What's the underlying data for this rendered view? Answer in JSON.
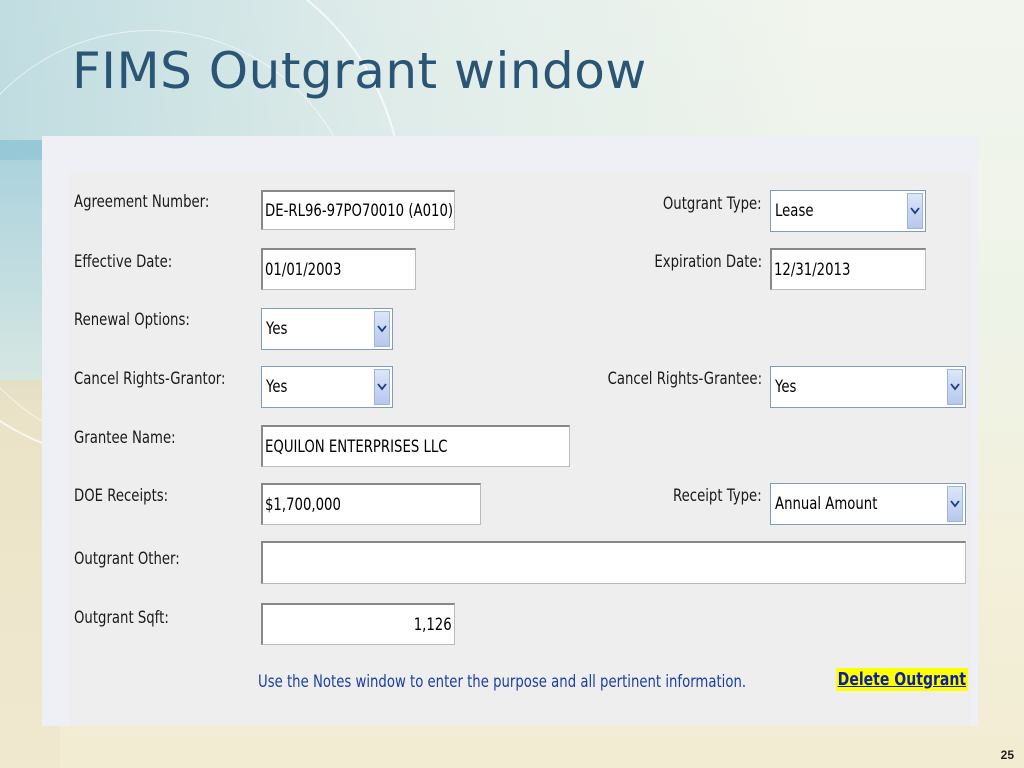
{
  "slide": {
    "title": "FIMS Outgrant window",
    "page_number": "25"
  },
  "form": {
    "agreement_number": {
      "label": "Agreement Number:",
      "value": "DE-RL96-97PO70010 (A010)"
    },
    "outgrant_type": {
      "label": "Outgrant Type:",
      "value": "Lease"
    },
    "effective_date": {
      "label": "Effective Date:",
      "value": "01/01/2003"
    },
    "expiration_date": {
      "label": "Expiration Date:",
      "value": "12/31/2013"
    },
    "renewal_options": {
      "label": "Renewal Options:",
      "value": "Yes"
    },
    "cancel_rights_grantor": {
      "label": "Cancel Rights-Grantor:",
      "value": "Yes"
    },
    "cancel_rights_grantee": {
      "label": "Cancel Rights-Grantee:",
      "value": "Yes"
    },
    "grantee_name": {
      "label": "Grantee Name:",
      "value": "EQUILON ENTERPRISES LLC"
    },
    "doe_receipts": {
      "label": "DOE Receipts:",
      "value": "$1,700,000"
    },
    "receipt_type": {
      "label": "Receipt Type:",
      "value": "Annual Amount"
    },
    "outgrant_other": {
      "label": "Outgrant Other:",
      "value": ""
    },
    "outgrant_sqft": {
      "label": "Outgrant Sqft:",
      "value": "1,126"
    },
    "note": "Use the Notes window to enter the purpose and all pertinent information.",
    "delete_label": "Delete Outgrant"
  },
  "colors": {
    "title": "#2a5575",
    "note": "#1a3fa0",
    "delete_link": "#0a1fa6",
    "delete_highlight": "#ffff00"
  },
  "icons": {
    "dropdown": "chevron-down-icon"
  }
}
